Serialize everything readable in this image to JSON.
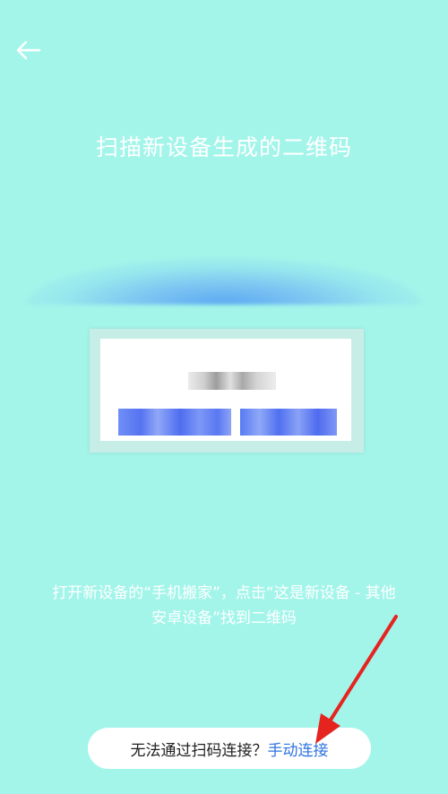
{
  "header": {
    "back_icon": "arrow-left-icon"
  },
  "title": "扫描新设备生成的二维码",
  "preview": {
    "blurred": true
  },
  "instruction": {
    "line1": "打开新设备的“手机搬家”，点击“这是新设备 - 其他",
    "line2": "安卓设备”找到二维码"
  },
  "footer": {
    "question": "无法通过扫码连接？",
    "link": "手动连接"
  },
  "colors": {
    "background": "#a3f5ea",
    "link": "#2f73e0",
    "annotation_arrow": "#e52420"
  }
}
